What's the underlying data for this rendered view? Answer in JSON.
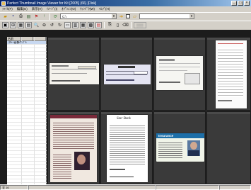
{
  "window": {
    "title": "Perfect Thumbnail Image Viewer for Kit [2005] (66) [Disk]",
    "controls": [
      "_",
      "□",
      "×"
    ]
  },
  "menu": [
    "ﾌｧｲﾙ(F)",
    "編集(E)",
    "表示(V)",
    "ｲﾒｰｼﾞ(I)",
    "ｵﾌﾟｼｮﾝ(O)",
    "ｳｨﾝﾄﾞｳ(W)",
    "ﾍﾙﾌﾟ(H)"
  ],
  "toolbar": {
    "path_value": "C:\\",
    "filter_value": ""
  },
  "left_pane": {
    "columns": [
      "名前",
      "",
      ""
    ],
    "rows": [
      "ｽｷｬﾝ画像/ｻﾝﾌﾟﾙ"
    ]
  },
  "thumbnails": {
    "cheque_title": "",
    "card_title": "Insurance",
    "doc_title": "Star Bank"
  },
  "statusbar": {
    "left": "全 16",
    "mid": "",
    "right": "",
    "right2": ""
  }
}
